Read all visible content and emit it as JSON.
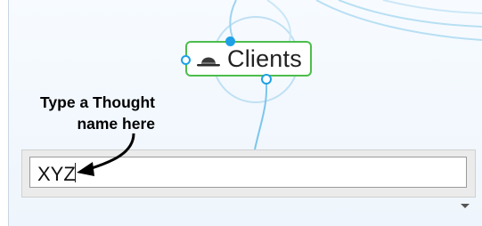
{
  "thought": {
    "label": "Clients",
    "icon": "hat-icon"
  },
  "callout": {
    "line1": "Type a Thought",
    "line2": "name here"
  },
  "name_input": {
    "value": "XYZ"
  },
  "colors": {
    "thought_border": "#4cbe4c",
    "gate": "#1ea0e6",
    "link": "#9fd3f0"
  },
  "icons": [
    "hat-icon",
    "arrow-icon",
    "chevron-down-icon"
  ]
}
